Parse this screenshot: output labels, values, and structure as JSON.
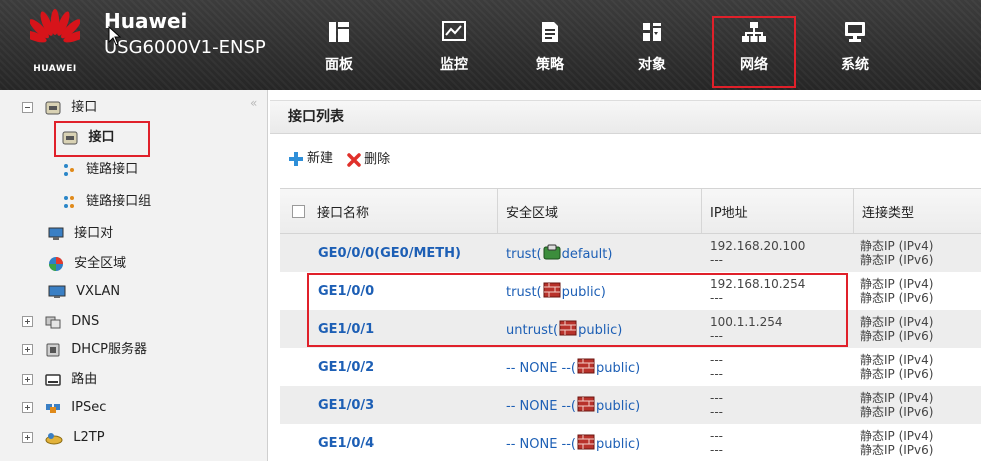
{
  "header": {
    "logo_word": "HUAWEI",
    "brand_title": "Huawei",
    "model": "USG6000V1-ENSP",
    "nav": [
      {
        "label": "面板",
        "icon": "dashboard-icon"
      },
      {
        "label": "监控",
        "icon": "monitor-icon"
      },
      {
        "label": "策略",
        "icon": "policy-icon"
      },
      {
        "label": "对象",
        "icon": "object-icon"
      },
      {
        "label": "网络",
        "icon": "network-icon",
        "selected": true
      },
      {
        "label": "系统",
        "icon": "system-icon"
      }
    ]
  },
  "sidebar": {
    "collapse_glyph": "«",
    "items": [
      {
        "label": "接口",
        "icon": "interface-icon",
        "expander": "minus"
      },
      {
        "label": "接口",
        "icon": "interface-icon",
        "selected": true
      },
      {
        "label": "链路接口",
        "icon": "link-interface-icon"
      },
      {
        "label": "链路接口组",
        "icon": "link-interface-group-icon"
      },
      {
        "label": "接口对",
        "icon": "interface-pair-icon"
      },
      {
        "label": "安全区域",
        "icon": "security-zone-icon"
      },
      {
        "label": "VXLAN",
        "icon": "vxlan-icon"
      },
      {
        "label": "DNS",
        "icon": "dns-icon",
        "expander": "plus"
      },
      {
        "label": "DHCP服务器",
        "icon": "dhcp-server-icon",
        "expander": "plus"
      },
      {
        "label": "路由",
        "icon": "route-icon",
        "expander": "plus"
      },
      {
        "label": "IPSec",
        "icon": "ipsec-icon",
        "expander": "plus"
      },
      {
        "label": "L2TP",
        "icon": "l2tp-icon",
        "expander": "plus"
      }
    ]
  },
  "main": {
    "panel_title": "接口列表",
    "toolbar": {
      "new_label": "新建",
      "delete_label": "删除"
    },
    "columns": [
      "接口名称",
      "安全区域",
      "IP地址",
      "连接类型"
    ],
    "rows": [
      {
        "name": "GE0/0/0(GE0/METH)",
        "zone_prefix": "trust(",
        "zone": "default)",
        "ip1": "192.168.20.100",
        "ip2": "---",
        "type1": "静态IP (IPv4)",
        "type2": "静态IP (IPv6)"
      },
      {
        "name": "GE1/0/0",
        "zone_prefix": "trust(",
        "zone": "public)",
        "ip1": "192.168.10.254",
        "ip2": "---",
        "type1": "静态IP (IPv4)",
        "type2": "静态IP (IPv6)"
      },
      {
        "name": "GE1/0/1",
        "zone_prefix": "untrust(",
        "zone": "public)",
        "ip1": "100.1.1.254",
        "ip2": "---",
        "type1": "静态IP (IPv4)",
        "type2": "静态IP (IPv6)"
      },
      {
        "name": "GE1/0/2",
        "zone_prefix": "-- NONE --(",
        "zone": "public)",
        "ip1": "---",
        "ip2": "---",
        "type1": "静态IP (IPv4)",
        "type2": "静态IP (IPv6)"
      },
      {
        "name": "GE1/0/3",
        "zone_prefix": "-- NONE --(",
        "zone": "public)",
        "ip1": "---",
        "ip2": "---",
        "type1": "静态IP (IPv4)",
        "type2": "静态IP (IPv6)"
      },
      {
        "name": "GE1/0/4",
        "zone_prefix": "-- NONE --(",
        "zone": "public)",
        "ip1": "---",
        "ip2": "---",
        "type1": "静态IP (IPv4)",
        "type2": "静态IP (IPv6)"
      }
    ]
  },
  "colors": {
    "header_bg": "#2f2f2f",
    "highlight": "#e0202a",
    "link": "#1d5fb5",
    "brand_red": "#cf1322"
  }
}
